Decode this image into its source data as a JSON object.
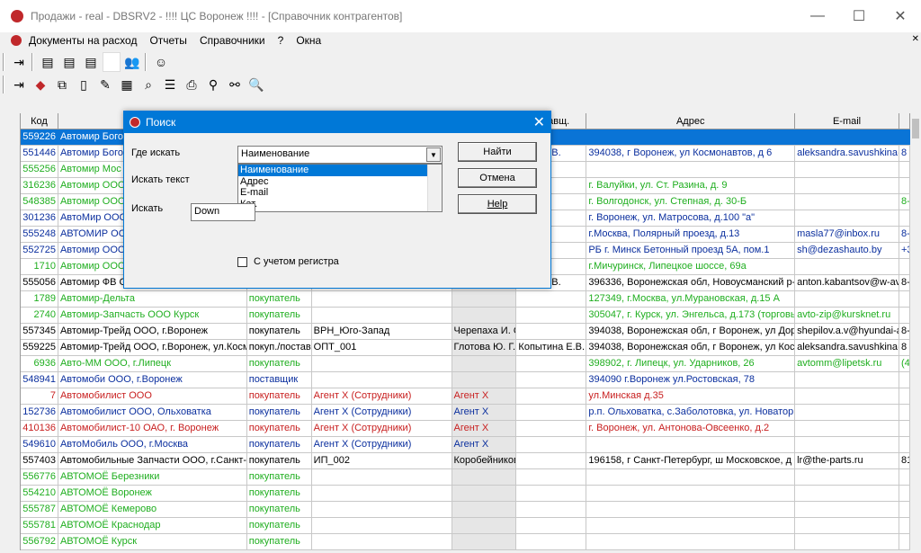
{
  "window": {
    "title": "Продажи - real - DBSRV2  -    !!!!  ЦС Воронеж  !!!! - [Справочник контрагентов]",
    "minimize": "—",
    "maximize": "☐",
    "close": "✕"
  },
  "menu": {
    "items": [
      "Документы на расход",
      "Отчеты",
      "Справочники",
      "?",
      "Окна"
    ],
    "mdi_close": "✕"
  },
  "grid": {
    "headers": [
      "Код",
      "Н",
      "",
      "",
      "",
      "оставщ.",
      "Адрес",
      "E-mail",
      ""
    ],
    "rows": [
      {
        "style": "sel",
        "cells": [
          "559226",
          "Автомир Бого",
          "",
          "",
          "",
          "",
          "",
          "",
          ""
        ]
      },
      {
        "style": "blue",
        "cells": [
          "551446",
          "Автомир Бого",
          "",
          "",
          "",
          "тина  Е.В.",
          "394038, г Воронеж, ул Космонавтов, д 6",
          "aleksandra.savushkina@",
          "8"
        ]
      },
      {
        "style": "green",
        "cells": [
          "555256",
          "Автомир Мос",
          "",
          "",
          "",
          "",
          "",
          "",
          ""
        ]
      },
      {
        "style": "green",
        "cells": [
          "316236",
          "Автомир ООО",
          "",
          "",
          "",
          "",
          "г. Валуйки, ул. Ст. Разина, д. 9",
          "",
          ""
        ]
      },
      {
        "style": "green",
        "cells": [
          "548385",
          "Автомир ООО",
          "",
          "",
          "",
          "",
          "г. Волгодонск, ул. Степная, д. 30-Б",
          "",
          "8-"
        ]
      },
      {
        "style": "blue",
        "cells": [
          "301236",
          "АвтоМир ООО",
          "",
          "",
          "",
          "",
          "г. Воронеж, ул. Матросова, д.100 \"а\"",
          "",
          ""
        ]
      },
      {
        "style": "blue",
        "cells": [
          "555248",
          "АВТОМИР ОО",
          "",
          "",
          "",
          "",
          "г.Москва, Полярный проезд, д.13",
          "masla77@inbox.ru",
          "8-"
        ]
      },
      {
        "style": "blue",
        "cells": [
          "552725",
          "Автомир ООО",
          "",
          "",
          "",
          "",
          "РБ г. Минск Бетонный проезд 5А, пом.1",
          "sh@dezashauto.by",
          "+3"
        ]
      },
      {
        "style": "green",
        "cells": [
          "1710",
          "Автомир ООО",
          "",
          "",
          "",
          "",
          "г.Мичуринск, Липецкое шоссе, 69а",
          "",
          ""
        ]
      },
      {
        "style": "black",
        "cells": [
          "555056",
          "Автомир ФВ С",
          "",
          "",
          "",
          "тина  Е.В.",
          "396336, Воронежская обл, Новоусманский р-н",
          "anton.kabantsov@w-avto",
          "8-"
        ]
      },
      {
        "style": "green",
        "cells": [
          "1789",
          "Автомир-Дельта",
          "покупатель",
          "",
          "",
          "",
          "127349, г.Москва, ул.Мурановская, д.15 А",
          "",
          ""
        ]
      },
      {
        "style": "green",
        "cells": [
          "2740",
          "Автомир-Запчасть ООО  Курск",
          "покупатель",
          "",
          "",
          "",
          "305047, г. Курск, ул. Энгельса, д.173 (торговый",
          "avto-zip@kursknet.ru",
          ""
        ]
      },
      {
        "style": "black",
        "cells": [
          "557345",
          "Автомир-Трейд ООО, г.Воронеж",
          "покупатель",
          "ВРН_Юго-Запад",
          "Черепаха И. О.",
          "",
          "394038, Воронежская обл, г Воронеж, ул Доро",
          "shepilov.a.v@hyundai-av",
          "8-"
        ]
      },
      {
        "style": "black",
        "cells": [
          "559225",
          "Автомир-Трейд ООО, г.Воронеж, ул.Космонавтов",
          "покуп./постав.",
          "ОПТ_001",
          "Глотова Ю. Г.",
          "Копытина  Е.В.",
          "394038, Воронежская обл, г Воронеж, ул Косм",
          "aleksandra.savushkina@",
          "8"
        ]
      },
      {
        "style": "green",
        "cells": [
          "6936",
          "Авто-ММ ООО, г.Липецк",
          "покупатель",
          "",
          "",
          "",
          "398902, г. Липецк, ул. Ударников, 26",
          "avtomm@lipetsk.ru",
          "(4"
        ]
      },
      {
        "style": "blue",
        "cells": [
          "548941",
          "Автомоби ООО, г.Воронеж",
          "поставщик",
          "",
          "",
          "",
          "394090 г.Воронеж ул.Ростовская,  78",
          "",
          ""
        ]
      },
      {
        "style": "red",
        "cells": [
          "7",
          "Автомобилист ООО",
          "покупатель",
          "Агент Х (Сотрудники)",
          "Агент Х",
          "",
          "ул.Минская д.35",
          "",
          ""
        ]
      },
      {
        "style": "blue",
        "cells": [
          "152736",
          "Автомобилист ООО, Ольховатка",
          "покупатель",
          "Агент Х (Сотрудники)",
          "Агент Х",
          "",
          "р.п. Ольховатка, с.Заболотовка, ул. Новатор",
          "",
          ""
        ]
      },
      {
        "style": "red",
        "cells": [
          "410136",
          "Автомобилист-10 ОАО, г. Воронеж",
          "покупатель",
          "Агент Х (Сотрудники)",
          "Агент Х",
          "",
          "г. Воронеж, ул. Антонова-Овсеенко, д.2",
          "",
          ""
        ]
      },
      {
        "style": "blue",
        "cells": [
          "549610",
          "АвтоМобиль ООО, г.Москва",
          "покупатель",
          "Агент Х (Сотрудники)",
          "Агент Х",
          "",
          "",
          "",
          ""
        ]
      },
      {
        "style": "black",
        "cells": [
          "557403",
          "Автомобильные Запчасти ООО, г.Санкт-",
          "покупатель",
          "ИП_002",
          "Коробейникова",
          "",
          "196158, г Санкт-Петербург, ш Московское, д",
          "lr@the-parts.ru",
          "81"
        ]
      },
      {
        "style": "green",
        "cells": [
          "556776",
          "АВТОМОЁ Березники",
          "покупатель",
          "",
          "",
          "",
          "",
          "",
          ""
        ]
      },
      {
        "style": "green",
        "cells": [
          "554210",
          "АВТОМОЁ Воронеж",
          "покупатель",
          "",
          "",
          "",
          "",
          "",
          ""
        ]
      },
      {
        "style": "green",
        "cells": [
          "555787",
          "АВТОМОЁ Кемерово",
          "покупатель",
          "",
          "",
          "",
          "",
          "",
          ""
        ]
      },
      {
        "style": "green",
        "cells": [
          "555781",
          "АВТОМОЁ Краснодар",
          "покупатель",
          "",
          "",
          "",
          "",
          "",
          ""
        ]
      },
      {
        "style": "green",
        "cells": [
          "556792",
          "АВТОМОЁ Курск",
          "покупатель",
          "",
          "",
          "",
          "",
          "",
          ""
        ]
      }
    ]
  },
  "dialog": {
    "title": "Поиск",
    "close": "✕",
    "where_label": "Где искать",
    "where_value": "Наименование",
    "where_options": [
      "Наименование",
      "Адрес",
      "E-mail",
      "Кат."
    ],
    "text_label": "Искать текст",
    "dir_label": "Искать",
    "dir_value": "Down",
    "case_label": "С учетом регистра",
    "find_button": "Найти",
    "cancel_button": "Отмена",
    "help_button": "Help"
  }
}
